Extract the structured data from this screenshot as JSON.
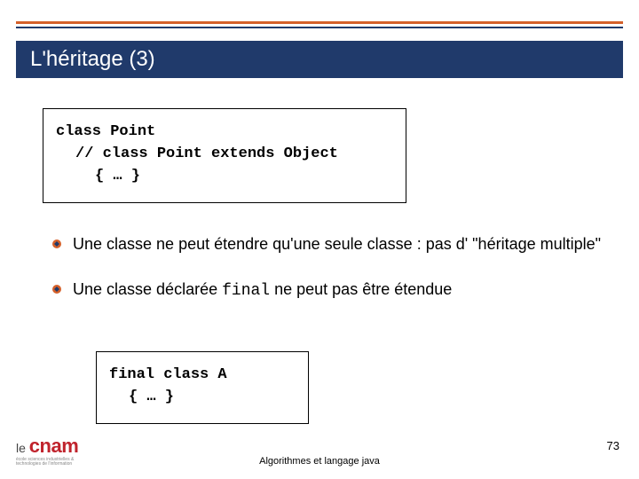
{
  "title": "L'héritage (3)",
  "code1": {
    "l1": "class Point",
    "l2": "// class Point extends Object",
    "l3": "{ … }"
  },
  "bullets": {
    "b1_a": "Une classe ne peut étendre qu'une seule classe : pas d' \"héritage multiple\"",
    "b2_a": "Une classe déclarée ",
    "b2_mono": "final",
    "b2_c": " ne peut pas être étendue"
  },
  "code2": {
    "l1": "final class A",
    "l2": "{ … }"
  },
  "footer": "Algorithmes et langage java",
  "pagenum": "73",
  "logo": {
    "le": "le ",
    "cnam": "cnam",
    "sub1": "école sciences industrielles &",
    "sub2": "technologies de l'information"
  }
}
